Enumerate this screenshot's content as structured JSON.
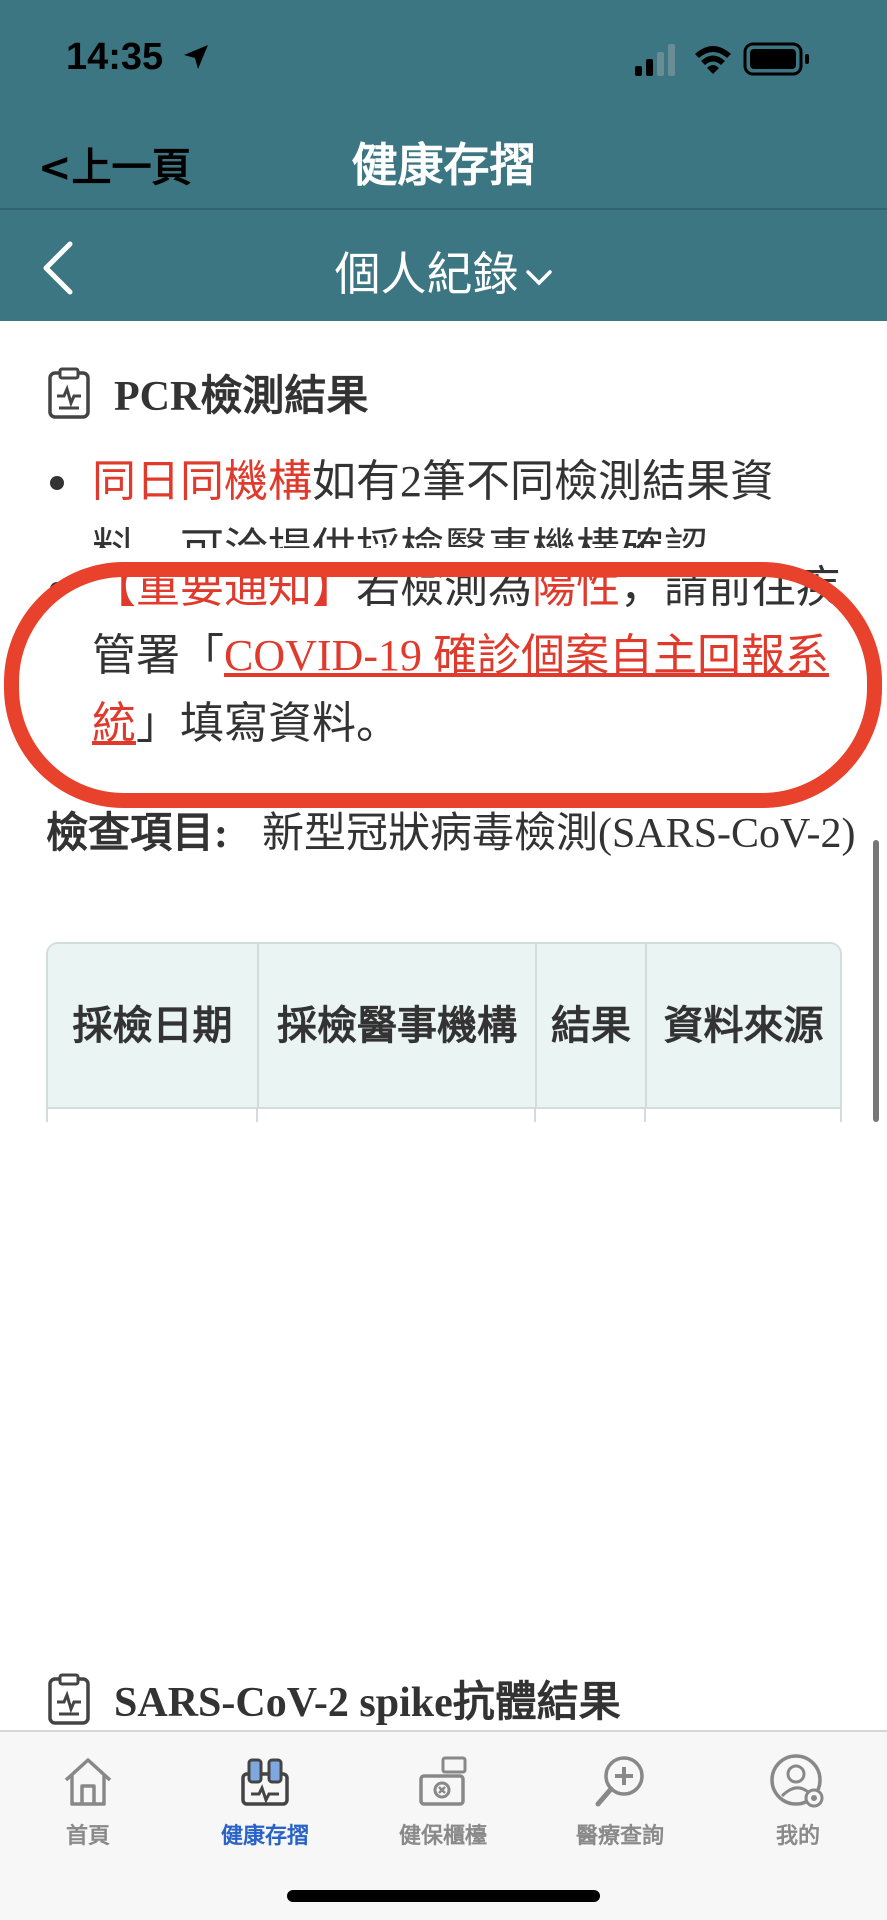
{
  "status_bar": {
    "time": "14:35"
  },
  "header": {
    "back_label": "<上一頁",
    "title": "健康存摺"
  },
  "subheader": {
    "title": "個人紀錄"
  },
  "pcr_section": {
    "title": "PCR檢測結果",
    "bullet1": {
      "red_part": "同日同機構",
      "text_part": "如有2筆不同檢測結果資料，可洽提供採檢醫事機構確認。"
    },
    "bullet2": {
      "red_prefix": "【重要通知】",
      "text1": "若檢測為",
      "red_word": "陽性",
      "text2": "，請前往疾管署「",
      "link_text": "COVID-19 確診個案自主回報系統",
      "text3": "」填寫資料。"
    },
    "check_item_label": "檢查項目:",
    "check_item_value": "新型冠狀病毒檢測(SARS-CoV-2)",
    "table_headers": [
      "採檢日期",
      "採檢醫事機構",
      "結果",
      "資料來源"
    ]
  },
  "spike_section": {
    "title": "SARS-CoV-2 spike抗體結果"
  },
  "tabbar": {
    "tabs": [
      {
        "label": "首頁",
        "icon": "home-icon"
      },
      {
        "label": "健康存摺",
        "icon": "health-passbook-icon",
        "active": true
      },
      {
        "label": "健保櫃檯",
        "icon": "counter-icon"
      },
      {
        "label": "醫療查詢",
        "icon": "medical-search-icon"
      },
      {
        "label": "我的",
        "icon": "profile-icon"
      }
    ]
  },
  "colors": {
    "header": "#3c7682",
    "accent_red": "#e03a2d",
    "highlight_ring": "#e8412c",
    "active_tab": "#2a63c8",
    "table_header_bg": "#eaf5f3"
  }
}
